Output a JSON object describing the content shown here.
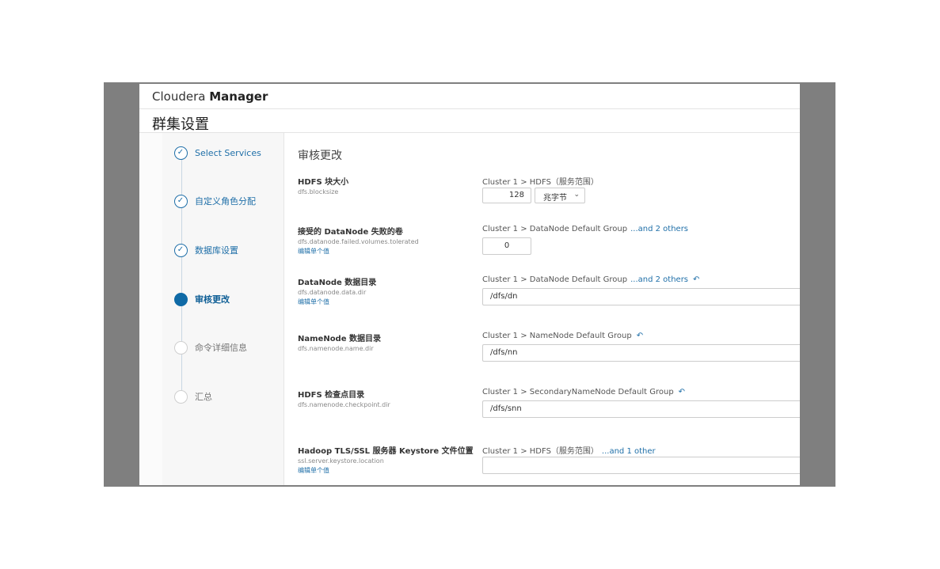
{
  "app": {
    "brand_light": "Cloudera",
    "brand_bold": "Manager"
  },
  "page_title": "群集设置",
  "steps": [
    {
      "label": "Select Services",
      "state": "done",
      "icon": "check-icon"
    },
    {
      "label": "自定义角色分配",
      "state": "done",
      "icon": "check-icon"
    },
    {
      "label": "数据库设置",
      "state": "done",
      "icon": "check-icon"
    },
    {
      "label": "审核更改",
      "state": "active"
    },
    {
      "label": "命令详细信息",
      "state": "todo"
    },
    {
      "label": "汇总",
      "state": "todo"
    }
  ],
  "content_title": "审核更改",
  "settings": [
    {
      "name": "HDFS 块大小",
      "key": "dfs.blocksize",
      "scope": "Cluster 1 > HDFS（服务范围）",
      "value": "128",
      "unit": "兆字节"
    },
    {
      "name": "接受的 DataNode 失败的卷",
      "key": "dfs.datanode.failed.volumes.tolerated",
      "edit": "编辑单个值",
      "scope": "Cluster 1 > DataNode Default Group",
      "more": "...and 2 others",
      "value": "0"
    },
    {
      "name": "DataNode 数据目录",
      "key": "dfs.datanode.data.dir",
      "edit": "编辑单个值",
      "scope": "Cluster 1 > DataNode Default Group",
      "more": "...and 2 others",
      "value": "/dfs/dn"
    },
    {
      "name": "NameNode 数据目录",
      "key": "dfs.namenode.name.dir",
      "scope": "Cluster 1 > NameNode Default Group",
      "value": "/dfs/nn"
    },
    {
      "name": "HDFS 检查点目录",
      "key": "dfs.namenode.checkpoint.dir",
      "scope": "Cluster 1 > SecondaryNameNode Default Group",
      "value": "/dfs/snn"
    },
    {
      "name": "Hadoop TLS/SSL 服务器 Keystore 文件位置",
      "key": "ssl.server.keystore.location",
      "edit": "编辑单个值",
      "scope": "Cluster 1 > HDFS（服务范围）",
      "more": "...and 1 other",
      "value": ""
    }
  ],
  "colors": {
    "accent": "#1f6fa8",
    "active_step": "#0f6aa6",
    "frame": "#7f7f7f"
  }
}
